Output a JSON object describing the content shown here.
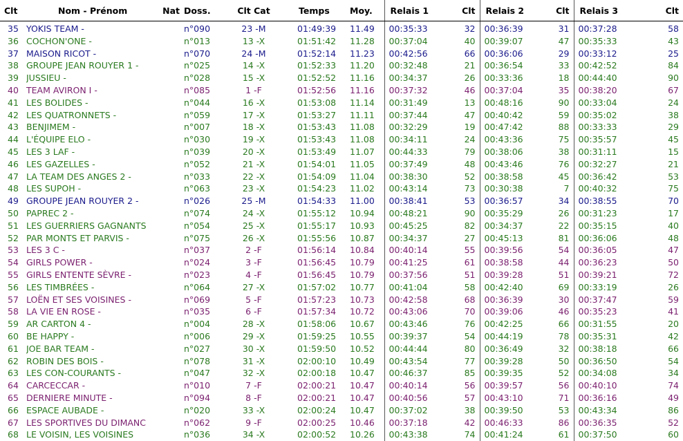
{
  "colors": {
    "M": "#1a1a8c",
    "X": "#2a7a1f",
    "F": "#7a1f6e",
    "header": "#000000"
  },
  "headers": {
    "clt": "Clt",
    "nom": "Nom - Prénom",
    "nat": "Nat",
    "doss": "Doss.",
    "cltcat": "Clt Cat",
    "temps": "Temps",
    "moy": "Moy.",
    "relais1": "Relais 1",
    "clt1": "Clt",
    "relais2": "Relais 2",
    "clt2": "Clt",
    "relais3": "Relais 3",
    "clt3": "Clt"
  },
  "rows": [
    {
      "rank": "35",
      "name": "YOKIS TEAM -",
      "doss": "n°090",
      "cat": "23 -M",
      "g": "M",
      "time": "01:49:39",
      "moy": "11.49",
      "r1": "00:35:33",
      "c1": "32",
      "r2": "00:36:39",
      "c2": "31",
      "r3": "00:37:28",
      "c3": "58"
    },
    {
      "rank": "36",
      "name": "COCHON'ONE -",
      "doss": "n°013",
      "cat": "13 -X",
      "g": "X",
      "time": "01:51:42",
      "moy": "11.28",
      "r1": "00:37:04",
      "c1": "40",
      "r2": "00:39:07",
      "c2": "47",
      "r3": "00:35:33",
      "c3": "43"
    },
    {
      "rank": "37",
      "name": "MAISON RICOT -",
      "doss": "n°070",
      "cat": "24 -M",
      "g": "M",
      "time": "01:52:14",
      "moy": "11.23",
      "r1": "00:42:56",
      "c1": "66",
      "r2": "00:36:06",
      "c2": "29",
      "r3": "00:33:12",
      "c3": "25"
    },
    {
      "rank": "38",
      "name": "GROUPE JEAN ROUYER 1 -",
      "doss": "n°025",
      "cat": "14 -X",
      "g": "X",
      "time": "01:52:33",
      "moy": "11.20",
      "r1": "00:32:48",
      "c1": "21",
      "r2": "00:36:54",
      "c2": "33",
      "r3": "00:42:52",
      "c3": "84"
    },
    {
      "rank": "39",
      "name": "JUSSIEU -",
      "doss": "n°028",
      "cat": "15 -X",
      "g": "X",
      "time": "01:52:52",
      "moy": "11.16",
      "r1": "00:34:37",
      "c1": "26",
      "r2": "00:33:36",
      "c2": "18",
      "r3": "00:44:40",
      "c3": "90"
    },
    {
      "rank": "40",
      "name": "TEAM AVIRON I -",
      "doss": "n°085",
      "cat": "1 -F",
      "g": "F",
      "time": "01:52:56",
      "moy": "11.16",
      "r1": "00:37:32",
      "c1": "46",
      "r2": "00:37:04",
      "c2": "35",
      "r3": "00:38:20",
      "c3": "67"
    },
    {
      "rank": "41",
      "name": "LES BOLIDES -",
      "doss": "n°044",
      "cat": "16 -X",
      "g": "X",
      "time": "01:53:08",
      "moy": "11.14",
      "r1": "00:31:49",
      "c1": "13",
      "r2": "00:48:16",
      "c2": "90",
      "r3": "00:33:04",
      "c3": "24"
    },
    {
      "rank": "42",
      "name": "LES QUATRONNETS -",
      "doss": "n°059",
      "cat": "17 -X",
      "g": "X",
      "time": "01:53:27",
      "moy": "11.11",
      "r1": "00:37:44",
      "c1": "47",
      "r2": "00:40:42",
      "c2": "59",
      "r3": "00:35:02",
      "c3": "38"
    },
    {
      "rank": "43",
      "name": "BENJIMEM -",
      "doss": "n°007",
      "cat": "18 -X",
      "g": "X",
      "time": "01:53:43",
      "moy": "11.08",
      "r1": "00:32:29",
      "c1": "19",
      "r2": "00:47:42",
      "c2": "88",
      "r3": "00:33:33",
      "c3": "29"
    },
    {
      "rank": "44",
      "name": "L'ÉQUIPE ELO -",
      "doss": "n°030",
      "cat": "19 -X",
      "g": "X",
      "time": "01:53:43",
      "moy": "11.08",
      "r1": "00:34:11",
      "c1": "24",
      "r2": "00:43:36",
      "c2": "75",
      "r3": "00:35:57",
      "c3": "45"
    },
    {
      "rank": "45",
      "name": "LES 3 LAF -",
      "doss": "n°039",
      "cat": "20 -X",
      "g": "X",
      "time": "01:53:49",
      "moy": "11.07",
      "r1": "00:44:33",
      "c1": "79",
      "r2": "00:38:06",
      "c2": "38",
      "r3": "00:31:11",
      "c3": "15"
    },
    {
      "rank": "46",
      "name": "LES GAZELLES -",
      "doss": "n°052",
      "cat": "21 -X",
      "g": "X",
      "time": "01:54:01",
      "moy": "11.05",
      "r1": "00:37:49",
      "c1": "48",
      "r2": "00:43:46",
      "c2": "76",
      "r3": "00:32:27",
      "c3": "21"
    },
    {
      "rank": "47",
      "name": "LA TEAM DES ANGES 2 -",
      "doss": "n°033",
      "cat": "22 -X",
      "g": "X",
      "time": "01:54:09",
      "moy": "11.04",
      "r1": "00:38:30",
      "c1": "52",
      "r2": "00:38:58",
      "c2": "45",
      "r3": "00:36:42",
      "c3": "53"
    },
    {
      "rank": "48",
      "name": "LES SUPOH -",
      "doss": "n°063",
      "cat": "23 -X",
      "g": "X",
      "time": "01:54:23",
      "moy": "11.02",
      "r1": "00:43:14",
      "c1": "73",
      "r2": "00:30:38",
      "c2": "7",
      "r3": "00:40:32",
      "c3": "75"
    },
    {
      "rank": "49",
      "name": "GROUPE JEAN ROUYER 2 -",
      "doss": "n°026",
      "cat": "25 -M",
      "g": "M",
      "time": "01:54:33",
      "moy": "11.00",
      "r1": "00:38:41",
      "c1": "53",
      "r2": "00:36:57",
      "c2": "34",
      "r3": "00:38:55",
      "c3": "70"
    },
    {
      "rank": "50",
      "name": "PAPREC 2 -",
      "doss": "n°074",
      "cat": "24 -X",
      "g": "X",
      "time": "01:55:12",
      "moy": "10.94",
      "r1": "00:48:21",
      "c1": "90",
      "r2": "00:35:29",
      "c2": "26",
      "r3": "00:31:23",
      "c3": "17"
    },
    {
      "rank": "51",
      "name": "LES GUERRIERS GAGNANTS",
      "doss": "n°054",
      "cat": "25 -X",
      "g": "X",
      "time": "01:55:17",
      "moy": "10.93",
      "r1": "00:45:25",
      "c1": "82",
      "r2": "00:34:37",
      "c2": "22",
      "r3": "00:35:15",
      "c3": "40"
    },
    {
      "rank": "52",
      "name": "PAR MONTS ET PARVIS -",
      "doss": "n°075",
      "cat": "26 -X",
      "g": "X",
      "time": "01:55:56",
      "moy": "10.87",
      "r1": "00:34:37",
      "c1": "27",
      "r2": "00:45:13",
      "c2": "81",
      "r3": "00:36:06",
      "c3": "48"
    },
    {
      "rank": "53",
      "name": "LES 3 C -",
      "doss": "n°037",
      "cat": "2 -F",
      "g": "F",
      "time": "01:56:14",
      "moy": "10.84",
      "r1": "00:40:14",
      "c1": "55",
      "r2": "00:39:56",
      "c2": "54",
      "r3": "00:36:05",
      "c3": "47"
    },
    {
      "rank": "54",
      "name": "GIRLS POWER -",
      "doss": "n°024",
      "cat": "3 -F",
      "g": "F",
      "time": "01:56:45",
      "moy": "10.79",
      "r1": "00:41:25",
      "c1": "61",
      "r2": "00:38:58",
      "c2": "44",
      "r3": "00:36:23",
      "c3": "50"
    },
    {
      "rank": "55",
      "name": "GIRLS ENTENTE SÈVRE -",
      "doss": "n°023",
      "cat": "4 -F",
      "g": "F",
      "time": "01:56:45",
      "moy": "10.79",
      "r1": "00:37:56",
      "c1": "51",
      "r2": "00:39:28",
      "c2": "51",
      "r3": "00:39:21",
      "c3": "72"
    },
    {
      "rank": "56",
      "name": "LES TIMBRÉES -",
      "doss": "n°064",
      "cat": "27 -X",
      "g": "X",
      "time": "01:57:02",
      "moy": "10.77",
      "r1": "00:41:04",
      "c1": "58",
      "r2": "00:42:40",
      "c2": "69",
      "r3": "00:33:19",
      "c3": "26"
    },
    {
      "rank": "57",
      "name": "LOËN ET SES VOISINES -",
      "doss": "n°069",
      "cat": "5 -F",
      "g": "F",
      "time": "01:57:23",
      "moy": "10.73",
      "r1": "00:42:58",
      "c1": "68",
      "r2": "00:36:39",
      "c2": "30",
      "r3": "00:37:47",
      "c3": "59"
    },
    {
      "rank": "58",
      "name": "LA VIE EN ROSE -",
      "doss": "n°035",
      "cat": "6 -F",
      "g": "F",
      "time": "01:57:34",
      "moy": "10.72",
      "r1": "00:43:06",
      "c1": "70",
      "r2": "00:39:06",
      "c2": "46",
      "r3": "00:35:23",
      "c3": "41"
    },
    {
      "rank": "59",
      "name": "AR CARTON 4 -",
      "doss": "n°004",
      "cat": "28 -X",
      "g": "X",
      "time": "01:58:06",
      "moy": "10.67",
      "r1": "00:43:46",
      "c1": "76",
      "r2": "00:42:25",
      "c2": "66",
      "r3": "00:31:55",
      "c3": "20"
    },
    {
      "rank": "60",
      "name": "BE HAPPY -",
      "doss": "n°006",
      "cat": "29 -X",
      "g": "X",
      "time": "01:59:25",
      "moy": "10.55",
      "r1": "00:39:37",
      "c1": "54",
      "r2": "00:44:19",
      "c2": "78",
      "r3": "00:35:31",
      "c3": "42"
    },
    {
      "rank": "61",
      "name": "JOE BAR TEAM -",
      "doss": "n°027",
      "cat": "30 -X",
      "g": "X",
      "time": "01:59:50",
      "moy": "10.52",
      "r1": "00:44:44",
      "c1": "80",
      "r2": "00:36:49",
      "c2": "32",
      "r3": "00:38:18",
      "c3": "66"
    },
    {
      "rank": "62",
      "name": "ROBIN DES BOIS -",
      "doss": "n°078",
      "cat": "31 -X",
      "g": "X",
      "time": "02:00:10",
      "moy": "10.49",
      "r1": "00:43:54",
      "c1": "77",
      "r2": "00:39:28",
      "c2": "50",
      "r3": "00:36:50",
      "c3": "54"
    },
    {
      "rank": "63",
      "name": "LES CON-COURANTS -",
      "doss": "n°047",
      "cat": "32 -X",
      "g": "X",
      "time": "02:00:18",
      "moy": "10.47",
      "r1": "00:46:37",
      "c1": "85",
      "r2": "00:39:35",
      "c2": "52",
      "r3": "00:34:08",
      "c3": "34"
    },
    {
      "rank": "64",
      "name": "CARCECCAR -",
      "doss": "n°010",
      "cat": "7 -F",
      "g": "F",
      "time": "02:00:21",
      "moy": "10.47",
      "r1": "00:40:14",
      "c1": "56",
      "r2": "00:39:57",
      "c2": "56",
      "r3": "00:40:10",
      "c3": "74"
    },
    {
      "rank": "65",
      "name": "DERNIERE MINUTE -",
      "doss": "n°094",
      "cat": "8 -F",
      "g": "F",
      "time": "02:00:21",
      "moy": "10.47",
      "r1": "00:40:56",
      "c1": "57",
      "r2": "00:43:10",
      "c2": "71",
      "r3": "00:36:16",
      "c3": "49"
    },
    {
      "rank": "66",
      "name": "ESPACE AUBADE -",
      "doss": "n°020",
      "cat": "33 -X",
      "g": "X",
      "time": "02:00:24",
      "moy": "10.47",
      "r1": "00:37:02",
      "c1": "38",
      "r2": "00:39:50",
      "c2": "53",
      "r3": "00:43:34",
      "c3": "86"
    },
    {
      "rank": "67",
      "name": "LES SPORTIVES DU DIMANC",
      "doss": "n°062",
      "cat": "9 -F",
      "g": "F",
      "time": "02:00:25",
      "moy": "10.46",
      "r1": "00:37:18",
      "c1": "42",
      "r2": "00:46:33",
      "c2": "86",
      "r3": "00:36:35",
      "c3": "52"
    },
    {
      "rank": "68",
      "name": "LE VOISIN, LES VOISINES",
      "doss": "n°036",
      "cat": "34 -X",
      "g": "X",
      "time": "02:00:52",
      "moy": "10.26",
      "r1": "00:43:38",
      "c1": "74",
      "r2": "00:41:24",
      "c2": "61",
      "r3": "00:37:50",
      "c3": "60"
    }
  ]
}
